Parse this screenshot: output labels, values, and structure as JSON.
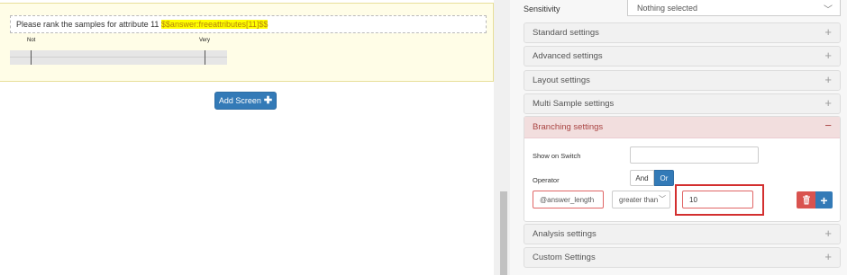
{
  "question": {
    "text": "Please rank the samples for attribute 11 ",
    "token": "$$answer:freeattributes[11]$$",
    "scale_low": "Not",
    "scale_high": "Very"
  },
  "add_screen": {
    "label": "Add Screen",
    "icon": "plus-icon"
  },
  "sensitivity": {
    "label": "Sensitivity",
    "value": "Nothing selected"
  },
  "panels": {
    "standard": "Standard settings",
    "advanced": "Advanced settings",
    "layout": "Layout settings",
    "multi_sample": "Multi Sample settings",
    "branching": "Branching settings",
    "analysis": "Analysis settings",
    "custom": "Custom Settings"
  },
  "branching": {
    "show_on_switch_label": "Show on Switch",
    "show_on_switch_value": "",
    "operator_label": "Operator",
    "and_label": "And",
    "or_label": "Or",
    "selected_operator": "Or",
    "condition": {
      "variable": "@answer_length",
      "comparator": "greater than",
      "value": "10"
    }
  },
  "colors": {
    "primary": "#337ab7",
    "danger": "#d9534f",
    "highlight": "#d32f2f",
    "branch_header_bg": "#f2dede",
    "branch_header_text": "#a94442",
    "question_bg": "#fffde7",
    "token_bg": "#ffff00"
  }
}
